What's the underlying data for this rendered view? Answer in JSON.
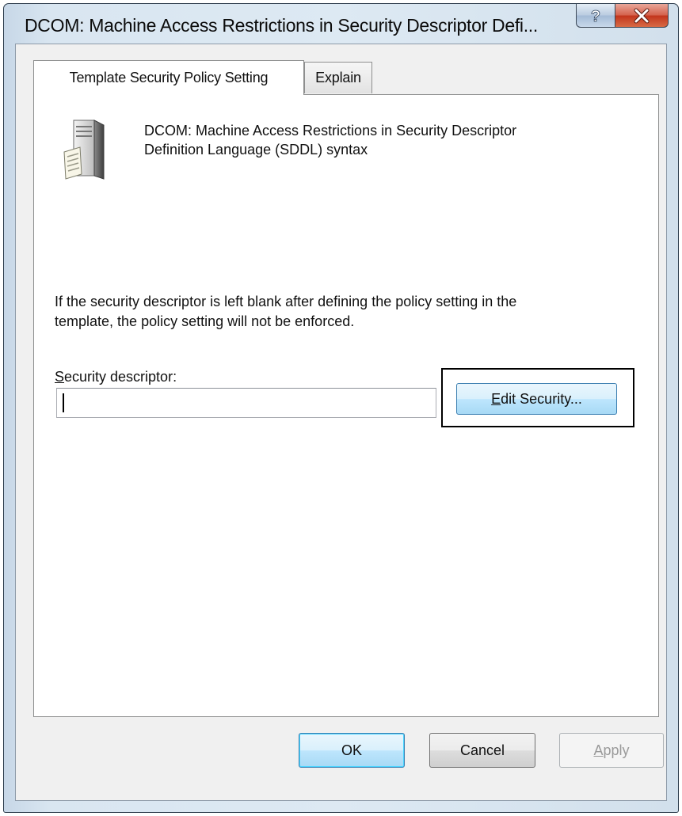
{
  "window": {
    "title": "DCOM: Machine Access Restrictions in Security Descriptor Defi...",
    "help_glyph": "?",
    "close_glyph": "x"
  },
  "tabs": [
    {
      "label": "Template Security Policy Setting",
      "selected": true
    },
    {
      "label": "Explain",
      "selected": false
    }
  ],
  "policy": {
    "icon": "server-icon",
    "name_line1": "DCOM: Machine Access Restrictions in Security Descriptor",
    "name_line2": "Definition Language (SDDL) syntax"
  },
  "info": {
    "line1": "If the security descriptor is left blank after defining the policy setting in the",
    "line2": "template, the policy setting will not be enforced."
  },
  "security_descriptor": {
    "label_mnemonic": "S",
    "label_rest": "ecurity descriptor:",
    "value": ""
  },
  "edit_button": {
    "mnemonic": "E",
    "rest": "dit Security..."
  },
  "footer": {
    "ok_label": "OK",
    "cancel_label": "Cancel",
    "apply_mnemonic": "A",
    "apply_rest": "pply",
    "apply_enabled": false
  },
  "colors": {
    "frame": "#d2e0ec",
    "close_red": "#c2341b",
    "accent_blue": "#3c7fb1"
  }
}
